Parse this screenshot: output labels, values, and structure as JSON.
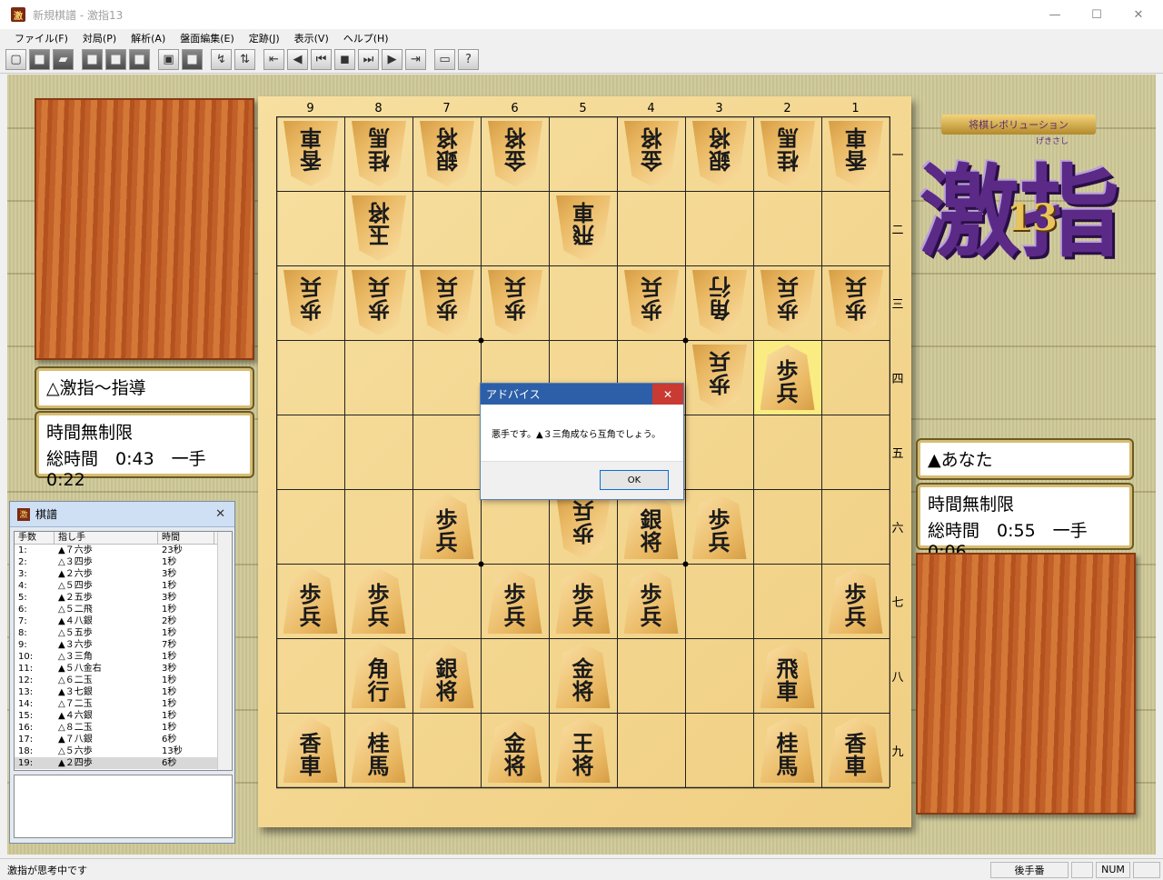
{
  "window": {
    "title": "新規棋譜 - 激指13",
    "app_icon_text": "激",
    "minimize": "—",
    "maximize": "☐",
    "close": "✕"
  },
  "menu": [
    "ファイル(F)",
    "対局(P)",
    "解析(A)",
    "盤面編集(E)",
    "定跡(J)",
    "表示(V)",
    "ヘルプ(H)"
  ],
  "toolbar_icons": [
    {
      "name": "new-icon",
      "glyph": "▢",
      "style": "light"
    },
    {
      "name": "open-icon",
      "glyph": "■",
      "style": "dark"
    },
    {
      "name": "save-icon",
      "glyph": "▰",
      "style": "dark"
    },
    {
      "sep": true
    },
    {
      "name": "undo-icon",
      "glyph": "■",
      "style": "dark"
    },
    {
      "name": "redo-icon",
      "glyph": "■",
      "style": "dark"
    },
    {
      "name": "board-icon",
      "glyph": "■",
      "style": "dark"
    },
    {
      "sep": true
    },
    {
      "name": "analyze-icon",
      "glyph": "▣",
      "style": "light"
    },
    {
      "name": "stop-icon",
      "glyph": "■",
      "style": "dark"
    },
    {
      "sep": true
    },
    {
      "name": "hint-icon",
      "glyph": "↯",
      "style": "light"
    },
    {
      "name": "flip-icon",
      "glyph": "⇅",
      "style": "light"
    },
    {
      "sep": true
    },
    {
      "name": "first-move-icon",
      "glyph": "⇤",
      "style": "light"
    },
    {
      "name": "prev-move-icon",
      "glyph": "◀",
      "style": "light"
    },
    {
      "name": "back-icon",
      "glyph": "⏮",
      "style": "light"
    },
    {
      "name": "stop-replay-icon",
      "glyph": "◼",
      "style": "light"
    },
    {
      "name": "forward-icon",
      "glyph": "⏭",
      "style": "light"
    },
    {
      "name": "next-move-icon",
      "glyph": "▶",
      "style": "light"
    },
    {
      "name": "last-move-icon",
      "glyph": "⇥",
      "style": "light"
    },
    {
      "sep": true
    },
    {
      "name": "monitor-icon",
      "glyph": "▭",
      "style": "light"
    },
    {
      "name": "help-icon",
      "glyph": "?",
      "style": "light"
    }
  ],
  "gote_player": {
    "name": "△激指〜指導",
    "time_mode": "時間無制限",
    "time_line": "総時間　0:43　一手　0:22"
  },
  "sente_player": {
    "name": "▲あなた",
    "time_mode": "時間無制限",
    "time_line": "総時間　0:55　一手　0:06"
  },
  "board": {
    "col_labels": [
      "9",
      "8",
      "7",
      "6",
      "5",
      "4",
      "3",
      "2",
      "1"
    ],
    "row_labels": [
      "一",
      "二",
      "三",
      "四",
      "五",
      "六",
      "七",
      "八",
      "九"
    ],
    "highlight": {
      "file": 2,
      "rank": 4
    },
    "pieces": [
      {
        "file": 9,
        "rank": 1,
        "side": "gote",
        "text": [
          "香",
          "車"
        ]
      },
      {
        "file": 8,
        "rank": 1,
        "side": "gote",
        "text": [
          "桂",
          "馬"
        ]
      },
      {
        "file": 7,
        "rank": 1,
        "side": "gote",
        "text": [
          "銀",
          "将"
        ]
      },
      {
        "file": 6,
        "rank": 1,
        "side": "gote",
        "text": [
          "金",
          "将"
        ]
      },
      {
        "file": 4,
        "rank": 1,
        "side": "gote",
        "text": [
          "金",
          "将"
        ]
      },
      {
        "file": 3,
        "rank": 1,
        "side": "gote",
        "text": [
          "銀",
          "将"
        ]
      },
      {
        "file": 2,
        "rank": 1,
        "side": "gote",
        "text": [
          "桂",
          "馬"
        ]
      },
      {
        "file": 1,
        "rank": 1,
        "side": "gote",
        "text": [
          "香",
          "車"
        ]
      },
      {
        "file": 8,
        "rank": 2,
        "side": "gote",
        "text": [
          "玉",
          "将"
        ]
      },
      {
        "file": 5,
        "rank": 2,
        "side": "gote",
        "text": [
          "飛",
          "車"
        ]
      },
      {
        "file": 9,
        "rank": 3,
        "side": "gote",
        "text": [
          "歩",
          "兵"
        ]
      },
      {
        "file": 8,
        "rank": 3,
        "side": "gote",
        "text": [
          "歩",
          "兵"
        ]
      },
      {
        "file": 7,
        "rank": 3,
        "side": "gote",
        "text": [
          "歩",
          "兵"
        ]
      },
      {
        "file": 6,
        "rank": 3,
        "side": "gote",
        "text": [
          "歩",
          "兵"
        ]
      },
      {
        "file": 4,
        "rank": 3,
        "side": "gote",
        "text": [
          "歩",
          "兵"
        ]
      },
      {
        "file": 3,
        "rank": 3,
        "side": "gote",
        "text": [
          "角",
          "行"
        ]
      },
      {
        "file": 2,
        "rank": 3,
        "side": "gote",
        "text": [
          "歩",
          "兵"
        ]
      },
      {
        "file": 1,
        "rank": 3,
        "side": "gote",
        "text": [
          "歩",
          "兵"
        ]
      },
      {
        "file": 3,
        "rank": 4,
        "side": "gote",
        "text": [
          "歩",
          "兵"
        ]
      },
      {
        "file": 2,
        "rank": 4,
        "side": "sente",
        "text": [
          "歩",
          "兵"
        ]
      },
      {
        "file": 5,
        "rank": 6,
        "side": "gote",
        "text": [
          "歩",
          "兵"
        ]
      },
      {
        "file": 7,
        "rank": 6,
        "side": "sente",
        "text": [
          "歩",
          "兵"
        ]
      },
      {
        "file": 4,
        "rank": 6,
        "side": "sente",
        "text": [
          "銀",
          "将"
        ]
      },
      {
        "file": 3,
        "rank": 6,
        "side": "sente",
        "text": [
          "歩",
          "兵"
        ]
      },
      {
        "file": 9,
        "rank": 7,
        "side": "sente",
        "text": [
          "歩",
          "兵"
        ]
      },
      {
        "file": 8,
        "rank": 7,
        "side": "sente",
        "text": [
          "歩",
          "兵"
        ]
      },
      {
        "file": 6,
        "rank": 7,
        "side": "sente",
        "text": [
          "歩",
          "兵"
        ]
      },
      {
        "file": 5,
        "rank": 7,
        "side": "sente",
        "text": [
          "歩",
          "兵"
        ]
      },
      {
        "file": 4,
        "rank": 7,
        "side": "sente",
        "text": [
          "歩",
          "兵"
        ]
      },
      {
        "file": 1,
        "rank": 7,
        "side": "sente",
        "text": [
          "歩",
          "兵"
        ]
      },
      {
        "file": 8,
        "rank": 8,
        "side": "sente",
        "text": [
          "角",
          "行"
        ]
      },
      {
        "file": 7,
        "rank": 8,
        "side": "sente",
        "text": [
          "銀",
          "将"
        ]
      },
      {
        "file": 5,
        "rank": 8,
        "side": "sente",
        "text": [
          "金",
          "将"
        ]
      },
      {
        "file": 2,
        "rank": 8,
        "side": "sente",
        "text": [
          "飛",
          "車"
        ]
      },
      {
        "file": 9,
        "rank": 9,
        "side": "sente",
        "text": [
          "香",
          "車"
        ]
      },
      {
        "file": 8,
        "rank": 9,
        "side": "sente",
        "text": [
          "桂",
          "馬"
        ]
      },
      {
        "file": 6,
        "rank": 9,
        "side": "sente",
        "text": [
          "金",
          "将"
        ]
      },
      {
        "file": 5,
        "rank": 9,
        "side": "sente",
        "text": [
          "王",
          "将"
        ]
      },
      {
        "file": 2,
        "rank": 9,
        "side": "sente",
        "text": [
          "桂",
          "馬"
        ]
      },
      {
        "file": 1,
        "rank": 9,
        "side": "sente",
        "text": [
          "香",
          "車"
        ]
      }
    ]
  },
  "logo": {
    "subtitle": "将棋レボリューション",
    "main": "激指",
    "number": "13",
    "ruby": "げきさし"
  },
  "kifu": {
    "title": "棋譜",
    "close": "✕",
    "headers": [
      "手数",
      "指し手",
      "時間"
    ],
    "rows": [
      [
        "1:",
        "▲７六歩",
        "23秒"
      ],
      [
        "2:",
        "△３四歩",
        "1秒"
      ],
      [
        "3:",
        "▲２六歩",
        "3秒"
      ],
      [
        "4:",
        "△５四歩",
        "1秒"
      ],
      [
        "5:",
        "▲２五歩",
        "3秒"
      ],
      [
        "6:",
        "△５二飛",
        "1秒"
      ],
      [
        "7:",
        "▲４八銀",
        "2秒"
      ],
      [
        "8:",
        "△５五歩",
        "1秒"
      ],
      [
        "9:",
        "▲３六歩",
        "7秒"
      ],
      [
        "10:",
        "△３三角",
        "1秒"
      ],
      [
        "11:",
        "▲５八金右",
        "3秒"
      ],
      [
        "12:",
        "△６二玉",
        "1秒"
      ],
      [
        "13:",
        "▲３七銀",
        "1秒"
      ],
      [
        "14:",
        "△７二玉",
        "1秒"
      ],
      [
        "15:",
        "▲４六銀",
        "1秒"
      ],
      [
        "16:",
        "△８二玉",
        "1秒"
      ],
      [
        "17:",
        "▲７八銀",
        "6秒"
      ],
      [
        "18:",
        "△５六歩",
        "13秒"
      ],
      [
        "19:",
        "▲２四歩",
        "6秒"
      ]
    ],
    "selected_index": 18
  },
  "dialog": {
    "title": "アドバイス",
    "close": "✕",
    "message": "悪手です。▲３三角成なら互角でしょう。",
    "ok": "OK"
  },
  "status": {
    "text": "激指が思考中です",
    "turn": "後手番",
    "num": "NUM"
  }
}
